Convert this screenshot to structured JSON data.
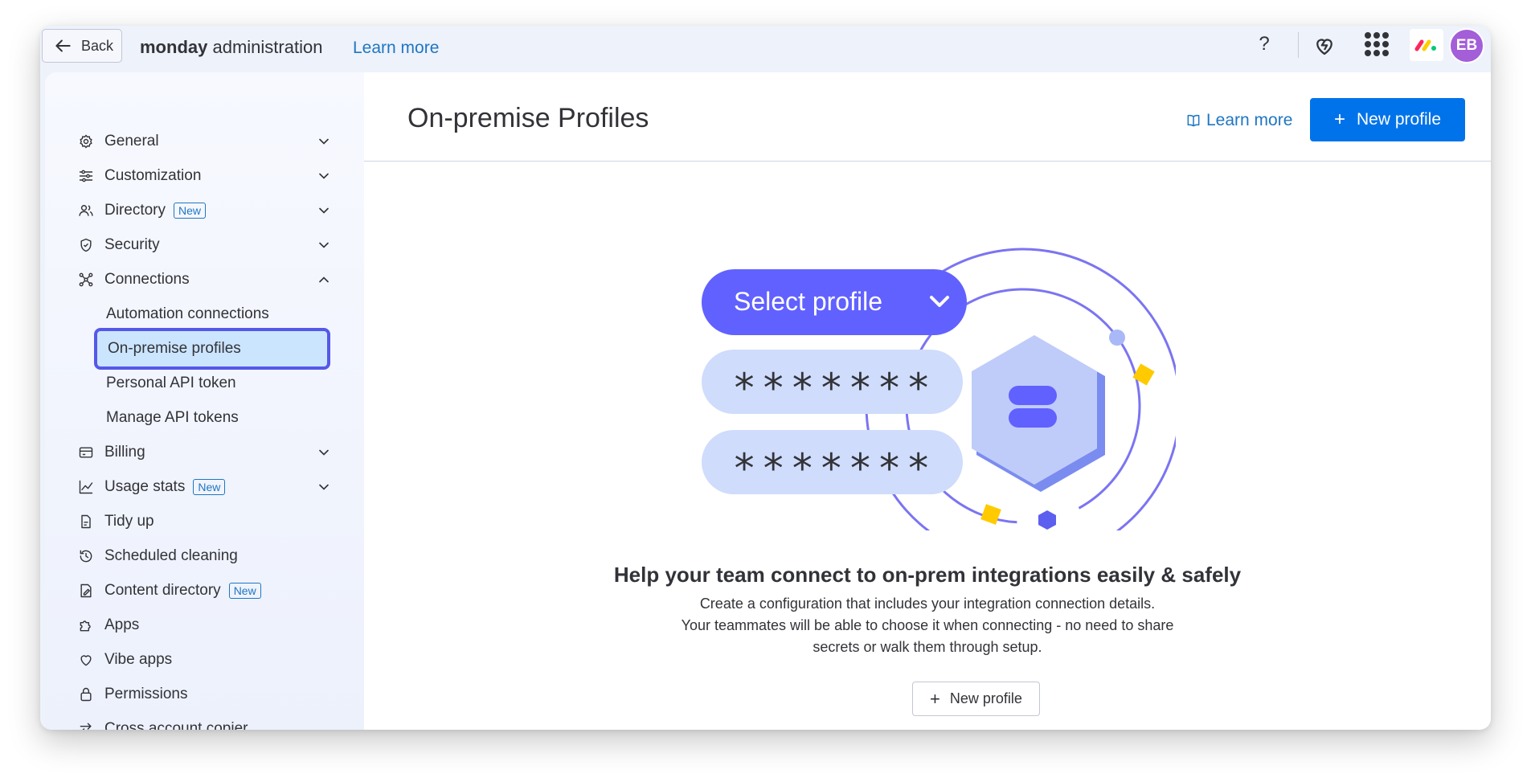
{
  "topbar": {
    "back_label": "Back",
    "brand_bold": "monday",
    "brand_rest": " administration",
    "learn_more": "Learn more",
    "help_label": "?",
    "avatar_initials": "EB",
    "avatar_color": "#a35ed8"
  },
  "sidebar": {
    "items": [
      {
        "label": "General",
        "icon": "gear-icon",
        "expandable": true
      },
      {
        "label": "Customization",
        "icon": "sliders-icon",
        "expandable": true
      },
      {
        "label": "Directory",
        "icon": "users-icon",
        "expandable": true,
        "badge": "New"
      },
      {
        "label": "Security",
        "icon": "shield-icon",
        "expandable": true
      },
      {
        "label": "Connections",
        "icon": "connections-icon",
        "expandable": true,
        "expanded": true
      },
      {
        "label": "Billing",
        "icon": "credit-card-icon",
        "expandable": true
      },
      {
        "label": "Usage stats",
        "icon": "chart-icon",
        "expandable": true,
        "badge": "New"
      },
      {
        "label": "Tidy up",
        "icon": "broom-icon"
      },
      {
        "label": "Scheduled cleaning",
        "icon": "history-icon"
      },
      {
        "label": "Content directory",
        "icon": "content-icon",
        "badge": "New"
      },
      {
        "label": "Apps",
        "icon": "puzzle-icon"
      },
      {
        "label": "Vibe apps",
        "icon": "heart-icon"
      },
      {
        "label": "Permissions",
        "icon": "lock-icon"
      },
      {
        "label": "Cross account copier",
        "icon": "swap-icon"
      }
    ],
    "connections_sub": [
      {
        "label": "Automation connections"
      },
      {
        "label": "On-premise profiles",
        "active": true
      },
      {
        "label": "Personal API token"
      },
      {
        "label": "Manage API tokens"
      }
    ]
  },
  "main": {
    "title": "On-premise Profiles",
    "learn_more": "Learn more",
    "new_profile": "New profile",
    "illustration": {
      "select_label": "Select profile",
      "password_1": "*******",
      "password_2": "*******"
    },
    "empty_title": "Help your team connect to on-prem integrations easily & safely",
    "empty_desc": [
      "Create a configuration that includes your integration connection details.",
      "Your teammates will be able to choose it when connecting - no need to share",
      "secrets or walk them through setup."
    ],
    "empty_button": "New profile"
  },
  "colors": {
    "primary": "#0073ea",
    "link": "#1f76c2",
    "active_bg": "#cce5ff",
    "active_border": "#5558e8",
    "illustration_purple": "#6161ff",
    "illustration_light": "#cfdcfb"
  }
}
